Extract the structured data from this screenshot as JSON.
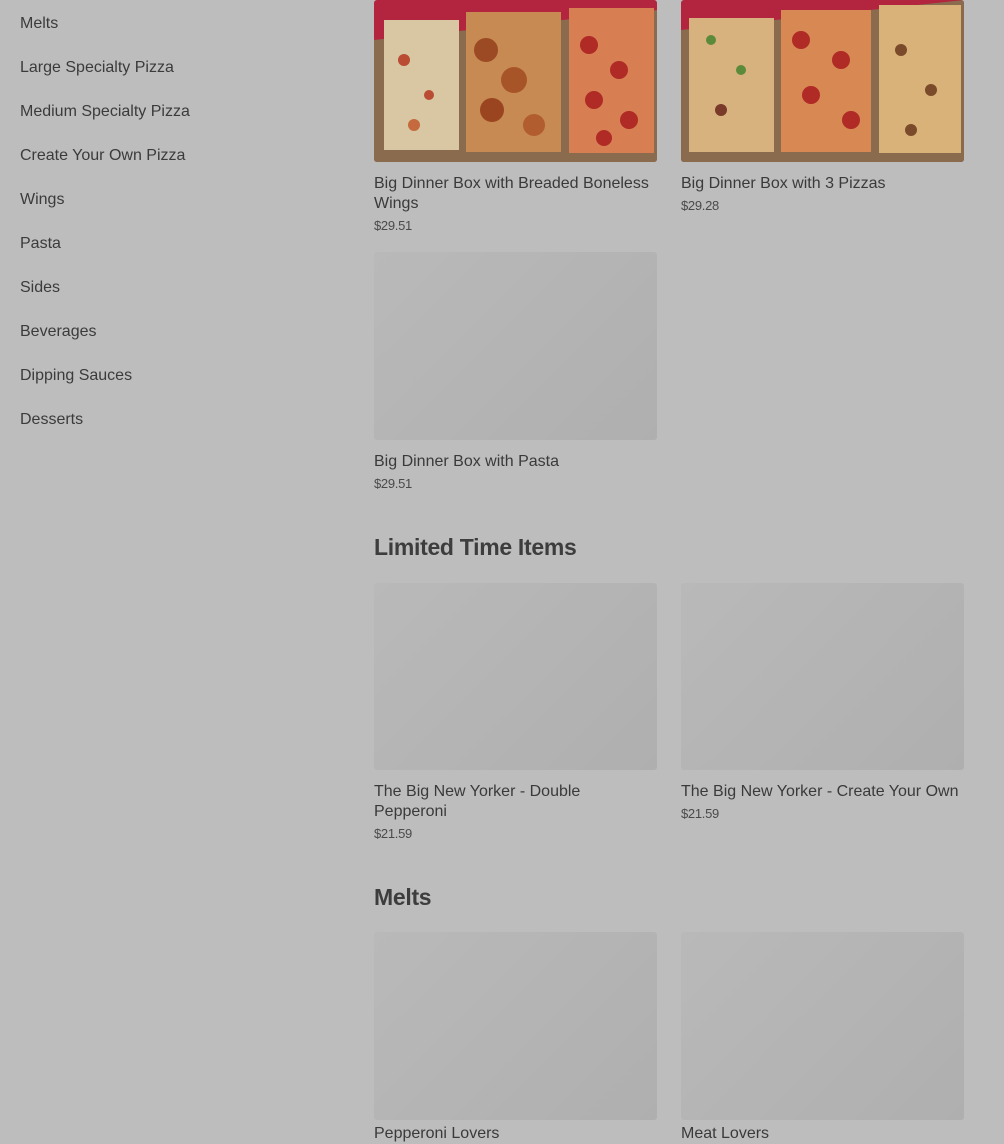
{
  "sidebar": {
    "items": [
      {
        "label": "Melts"
      },
      {
        "label": "Large Specialty Pizza"
      },
      {
        "label": "Medium Specialty Pizza"
      },
      {
        "label": "Create Your Own Pizza"
      },
      {
        "label": "Wings"
      },
      {
        "label": "Pasta"
      },
      {
        "label": "Sides"
      },
      {
        "label": "Beverages"
      },
      {
        "label": "Dipping Sauces"
      },
      {
        "label": "Desserts"
      }
    ]
  },
  "dinner_boxes": {
    "items": [
      {
        "name": "Big Dinner Box with Breaded Boneless Wings",
        "price": "$29.51"
      },
      {
        "name": "Big Dinner Box with 3 Pizzas",
        "price": "$29.28"
      },
      {
        "name": "Big Dinner Box with Pasta",
        "price": "$29.51"
      }
    ]
  },
  "limited_time": {
    "title": "Limited Time Items",
    "items": [
      {
        "name": "The Big New Yorker - Double Pepperoni",
        "price": "$21.59"
      },
      {
        "name": "The Big New Yorker - Create Your Own",
        "price": "$21.59"
      }
    ]
  },
  "melts": {
    "title": "Melts",
    "items": [
      {
        "name": "Pepperoni Lovers"
      },
      {
        "name": "Meat Lovers"
      }
    ]
  },
  "colors": {
    "page_bg": "#bdbdbd",
    "placeholder_bg": "#b3b3b3",
    "photo_bg": "#b3243f"
  }
}
